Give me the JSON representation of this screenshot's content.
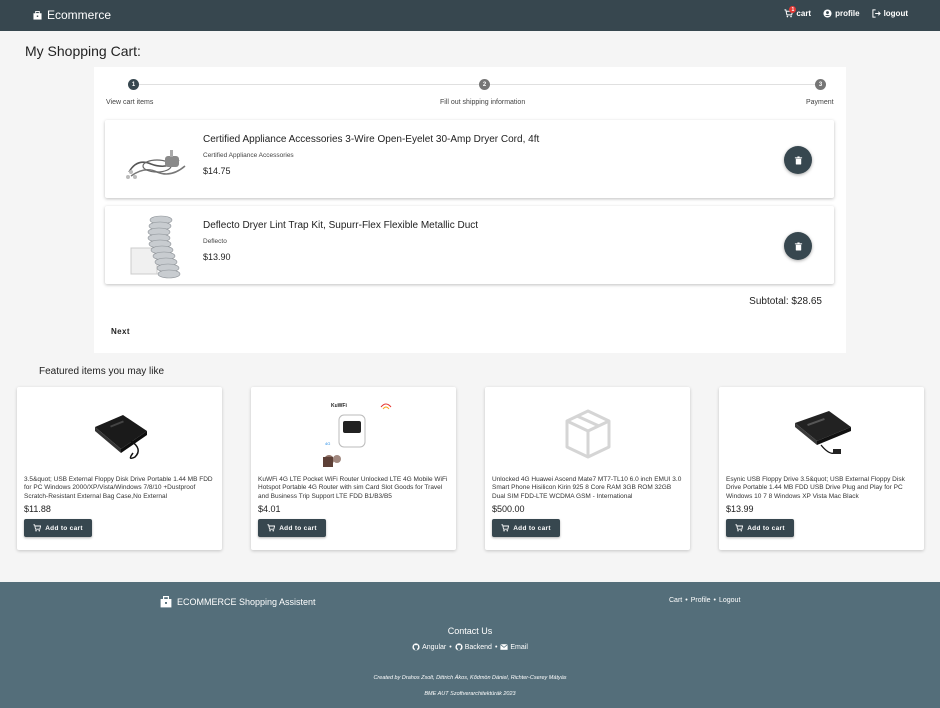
{
  "navbar": {
    "brand": "Ecommerce",
    "cart_label": "cart",
    "cart_count": "1",
    "profile_label": "profile",
    "logout_label": "logout"
  },
  "page_title": "My Shopping Cart:",
  "stepper": {
    "steps": [
      {
        "number": "1",
        "label": "View cart items",
        "state": "active"
      },
      {
        "number": "2",
        "label": "Fill out shipping information",
        "state": "inactive"
      },
      {
        "number": "3",
        "label": "Payment",
        "state": "inactive"
      }
    ]
  },
  "cart": {
    "items": [
      {
        "name": "Certified Appliance Accessories 3-Wire Open-Eyelet 30-Amp Dryer Cord, 4ft",
        "brand": "Certified Appliance Accessories",
        "price": "$14.75",
        "image": "dryer-cord-image"
      },
      {
        "name": "Deflecto Dryer Lint Trap Kit, Supurr-Flex Flexible Metallic Duct",
        "brand": "Deflecto",
        "price": "$13.90",
        "image": "dryer-duct-image"
      }
    ],
    "subtotal": "Subtotal: $28.65",
    "next_label": "Next"
  },
  "featured": {
    "title": "Featured items you may like",
    "add_label": "Add to cart",
    "products": [
      {
        "description": "3.5&quot; USB External Floppy Disk Drive Portable 1.44 MB FDD for PC Windows 2000/XP/Vista/Windows 7/8/10 +Dustproof Scratch-Resistant External Bag Case,No External",
        "price": "$11.88",
        "image": "floppy-drive-bag-image"
      },
      {
        "description": "KuWFi 4G LTE Pocket WiFi Router Unlocked LTE 4G Mobile WiFi Hotspot Portable 4G Router with sim Card Slot Goods for Travel and Business Trip Support LTE FDD B1/B3/B5",
        "price": "$4.01",
        "image": "wifi-router-image",
        "image_text": "KuWFi"
      },
      {
        "description": "Unlocked 4G Huawei Ascend Mate7 MT7-TL10 6.0 inch EMUI 3.0 Smart Phone Hisilicon Kirin 925 8 Core RAM 3GB ROM 32GB Dual SIM FDD-LTE WCDMA GSM - International",
        "price": "$500.00",
        "image": "package-placeholder-icon"
      },
      {
        "description": "Esynic USB Floppy Drive 3.5&quot; USB External Floppy Disk Drive Portable 1.44 MB FDD USB Drive Plug and Play for PC Windows 10 7 8 Windows XP Vista Mac Black",
        "price": "$13.99",
        "image": "floppy-drive-image"
      }
    ]
  },
  "footer": {
    "brand": "ECOMMERCE Shopping Assistent",
    "links": [
      "Cart",
      "Profile",
      "Logout"
    ],
    "separator": "•",
    "contact_title": "Contact Us",
    "contact_links": [
      "Angular",
      "Backend",
      "Email"
    ],
    "credits": "Created by Drahos Zsolt, Dittrich Ákos, Kődmön Dániel, Richter-Cserey Mátyás",
    "course": "BME AUT Szoftverarchitektúrák 2023"
  },
  "colors": {
    "navbar": "#37474f",
    "footer": "#546e7a",
    "accent": "#37474f",
    "badge": "#e53935"
  }
}
